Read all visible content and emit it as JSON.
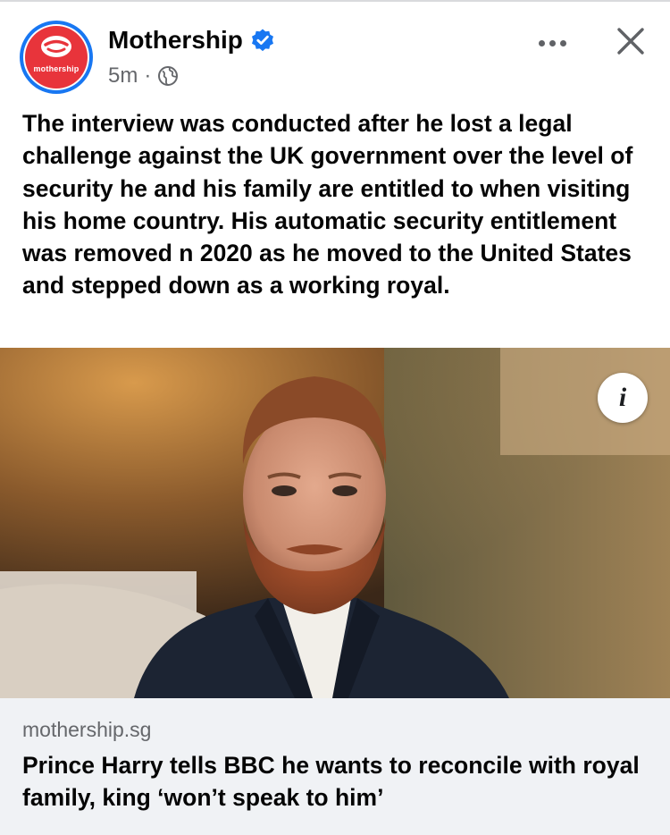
{
  "post": {
    "page_name": "Mothership",
    "avatar_label": "mothership",
    "time": "5m",
    "separator": "·",
    "privacy_icon": "globe-icon",
    "verified_icon": "verified-badge-icon",
    "body": "The interview was conducted after he lost a legal challenge against the UK government over the level of security he and his family are entitled to when visiting his home country. His automatic security entitlement was removed n 2020 as he moved to the United States and stepped down as a working royal."
  },
  "actions": {
    "more_icon": "more-options-icon",
    "close_icon": "close-icon"
  },
  "media": {
    "info_label": "i"
  },
  "link": {
    "domain": "mothership.sg",
    "title": "Prince Harry tells BBC he wants to reconcile with royal family, king ‘won’t speak to him’"
  },
  "colors": {
    "brand_red": "#e8343b",
    "facebook_blue": "#1877f2",
    "text_primary": "#050505",
    "text_secondary": "#65676b",
    "card_background": "#f0f2f5"
  }
}
